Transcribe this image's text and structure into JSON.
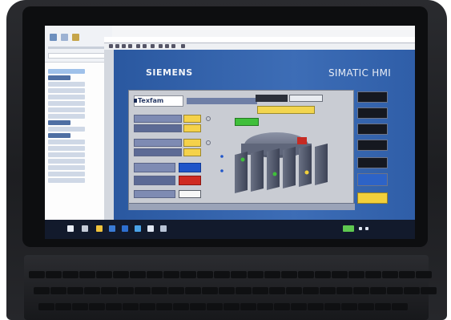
{
  "hmi": {
    "brand": "SIEMENS",
    "product": "SIMATIC HMI",
    "logo_text": "Texfam",
    "status_left": "",
    "status_right": "",
    "mode_selector": "",
    "green_button": "",
    "fields": [
      {
        "label": "",
        "value": ""
      },
      {
        "label": "",
        "value": ""
      },
      {
        "label": "",
        "value": ""
      },
      {
        "label": "",
        "value": ""
      },
      {
        "label": "",
        "value": ""
      },
      {
        "label": "",
        "value": ""
      },
      {
        "label": "",
        "value": ""
      }
    ],
    "bottom_strip": [
      "",
      "",
      ""
    ],
    "side_buttons": [
      "",
      "",
      "",
      "",
      "",
      "",
      ""
    ],
    "side_text": ""
  },
  "taskbar": {
    "clock_time": "",
    "clock_date": ""
  },
  "colors": {
    "panel_blue": "#2f5ea8",
    "value_yellow": "#f5d24a",
    "alarm_red": "#cf2b22",
    "ok_green": "#3fbf3a",
    "taskbar": "#121a2c"
  }
}
